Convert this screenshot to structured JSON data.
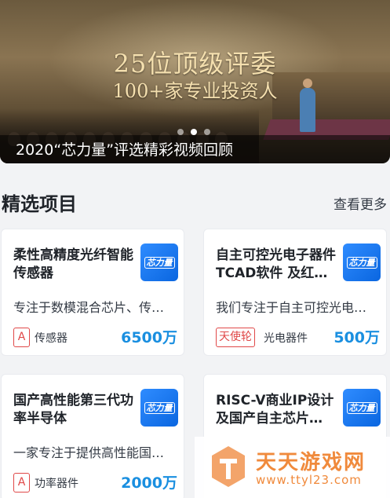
{
  "banner": {
    "headline": "25位顶级评委",
    "subline": "100+家专业投资人",
    "caption": "2020“芯力量”评选精彩视频回顾",
    "slide_count": 3,
    "active_slide": 2
  },
  "section": {
    "title": "精选项目",
    "more_label": "查看更多"
  },
  "projects": [
    {
      "name": "柔性高精度光纤智能传感器",
      "logo_text": "芯力量",
      "description": "专注于数模混合芯片、传…",
      "tag": "A",
      "category": "传感器",
      "amount": "6500万"
    },
    {
      "name": "自主可控光电子器件TCAD软件 及红…",
      "logo_text": "芯力量",
      "description": "我们专注于自主可控光电…",
      "tag": "天使轮",
      "category": "光电器件",
      "amount": "500万"
    },
    {
      "name": "国产高性能第三代功率半导体",
      "logo_text": "芯力量",
      "description": "一家专注于提供高性能国…",
      "tag": "A",
      "category": "功率器件",
      "amount": "2000万"
    },
    {
      "name": "RISC-V商业IP设计及国产自主芯片…",
      "logo_text": "芯力量",
      "description": "",
      "tag": "",
      "category": "",
      "amount": ""
    }
  ],
  "watermark": {
    "title": "天天游戏网",
    "url": "www.ttyl23.com"
  },
  "colors": {
    "accent_blue": "#1a8fe0",
    "tag_red": "#e04848",
    "watermark_orange": "#f08a3c",
    "page_background": "#f2f3f5"
  }
}
